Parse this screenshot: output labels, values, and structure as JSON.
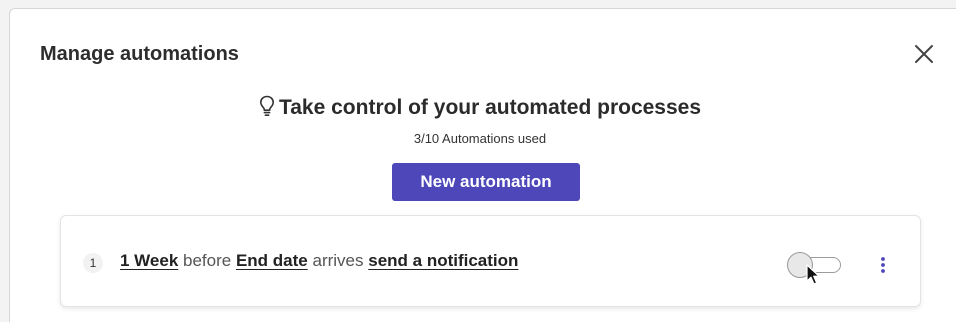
{
  "dialog": {
    "title": "Manage automations",
    "close_icon": "close-icon"
  },
  "header": {
    "icon": "lightbulb-icon",
    "headline": "Take control of your automated processes",
    "usage": "3/10 Automations used"
  },
  "actions": {
    "new_automation_label": "New automation",
    "accent_color": "#4e47b9"
  },
  "automations": [
    {
      "index": "1",
      "period": "1 Week",
      "text_before": "before",
      "field": "End date",
      "text_arrives": "arrives",
      "action": "send a notification",
      "enabled": false,
      "menu_icon": "more-vertical-icon"
    }
  ]
}
